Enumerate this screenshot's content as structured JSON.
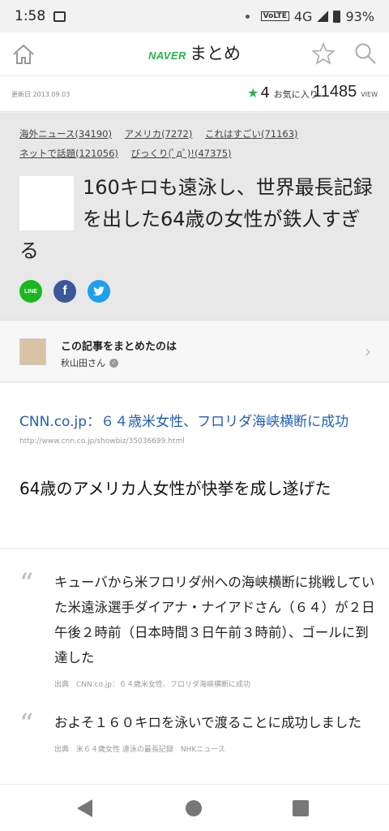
{
  "status": {
    "time": "1:58",
    "network": "4G",
    "volte": "VoLTE",
    "battery": "93%"
  },
  "header": {
    "naver": "NAVER",
    "matome": "まとめ"
  },
  "meta": {
    "updated": "更新日 2013.09.03",
    "favorites_count": "4",
    "favorites_label": "お気に入り",
    "views": "11485",
    "views_label": "VIEW"
  },
  "tags": [
    "海外ニュース(34190)",
    "アメリカ(7272)",
    "これはすごい(71163)",
    "ネットで話題(121056)",
    "びっくり(ﾟдﾟ)!(47375)"
  ],
  "article": {
    "title": "160キロも遠泳し、世界最長記録を出した64歳の女性が鉄人すぎる"
  },
  "share": {
    "line": "LINE",
    "facebook": "f",
    "twitter": "🐦"
  },
  "author": {
    "label": "この記事をまとめたのは",
    "name": "秋山田さん"
  },
  "link": {
    "title": "CNN.co.jp：６４歳米女性、フロリダ海峡横断に成功",
    "url": "http://www.cnn.co.jp/showbiz/35036699.html"
  },
  "heading": "64歳のアメリカ人女性が快挙を成し遂げた",
  "quotes": [
    {
      "text": "キューバから米フロリダ州への海峡横断に挑戦していた米遠泳選手ダイアナ・ナイアドさん（６４）が２日午後２時前（日本時間３日午前３時前）、ゴールに到達した",
      "source": "出典　CNN.co.jp：６４歳米女性、フロリダ海峡横断に成功"
    },
    {
      "text": "およそ１６０キロを泳いで渡ることに成功しました",
      "source": "出典　米６４歳女性 遠泳の最長記録　NHKニュース"
    }
  ],
  "colors": {
    "brand": "#2bb24c",
    "link": "#2060b0",
    "line": "#1bb71f",
    "facebook": "#3b5998",
    "twitter": "#1da1f2"
  }
}
